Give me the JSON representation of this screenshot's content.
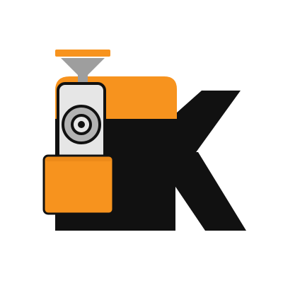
{
  "logo": {
    "icon": "coffee-roaster-k-logo",
    "colors": {
      "background": "#ffffff",
      "primary": "#111111",
      "accent": "#f7931e",
      "accent_dark": "#d97a10",
      "drum_light": "#e6e6e6",
      "drum_mid": "#b3b3b3",
      "hopper": "#9e9e9e"
    }
  }
}
